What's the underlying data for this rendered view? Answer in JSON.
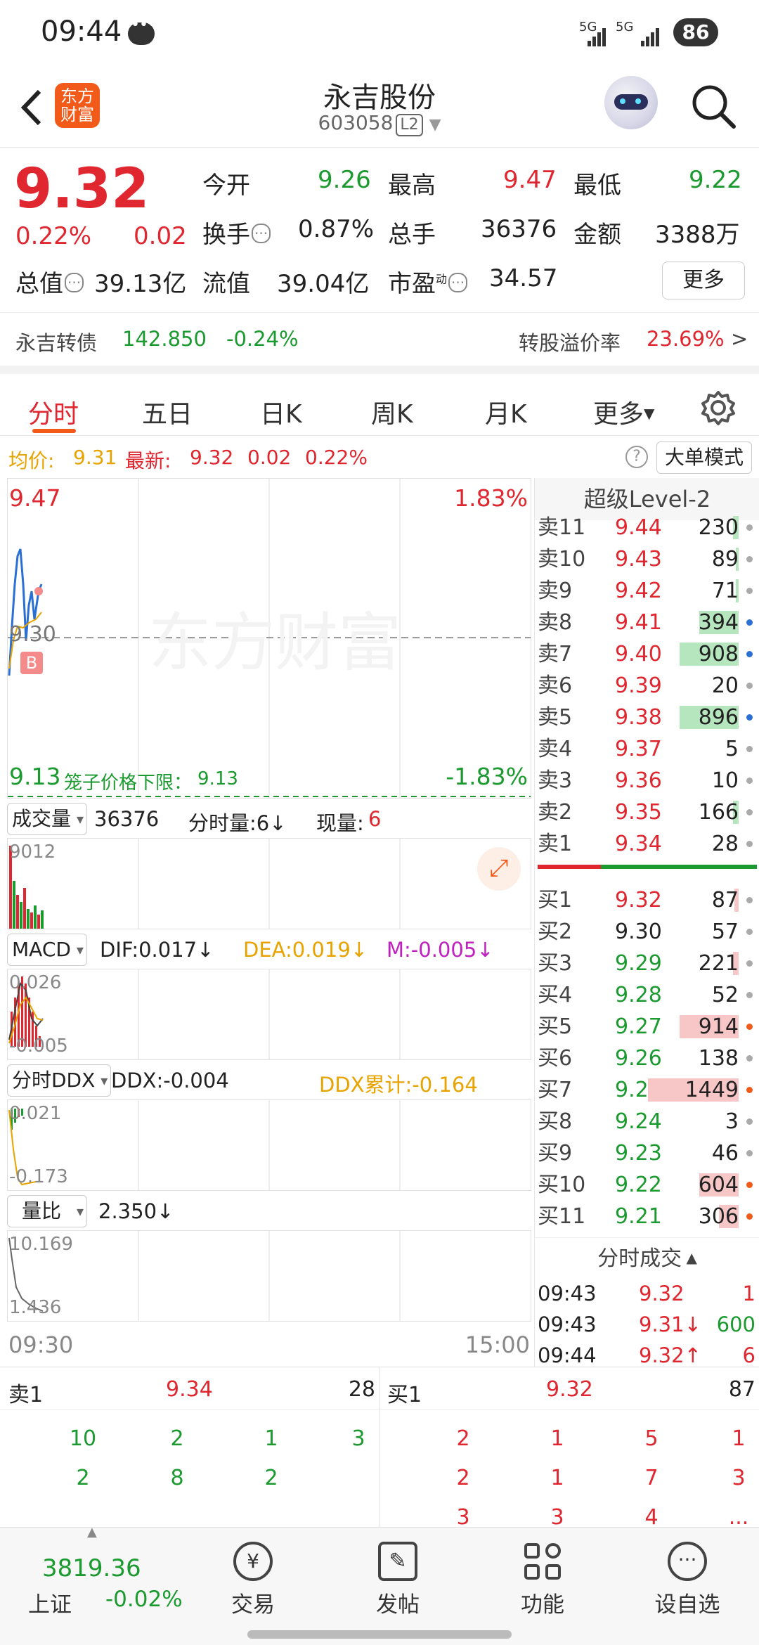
{
  "status": {
    "time": "09:44",
    "net1": "5G",
    "net2": "5G",
    "battery": "86"
  },
  "header": {
    "name": "永吉股份",
    "code": "603058",
    "level_badge": "L2",
    "logo_line1": "东方",
    "logo_line2": "财富"
  },
  "quote": {
    "price": "9.32",
    "change_pct": "0.22%",
    "change": "0.02",
    "open_label": "今开",
    "open": "9.26",
    "high_label": "最高",
    "high": "9.47",
    "low_label": "最低",
    "low": "9.22",
    "turnover_label": "换手",
    "turnover": "0.87%",
    "volume_label": "总手",
    "volume": "36376",
    "amount_label": "金额",
    "amount": "3388万",
    "mcap_label": "总值",
    "mcap": "39.13亿",
    "float_label": "流值",
    "float": "39.04亿",
    "pe_label": "市盈",
    "pe_sup": "动",
    "pe": "34.57",
    "more_label": "更多",
    "bond_name": "永吉转债",
    "bond_price": "142.850",
    "bond_change": "-0.24%",
    "premium_label": "转股溢价率",
    "premium": "23.69%",
    "premium_arrow": ">"
  },
  "tabs": [
    "分时",
    "五日",
    "日K",
    "周K",
    "月K",
    "更多"
  ],
  "avgline": {
    "avg_label": "均价:",
    "avg": "9.31",
    "last_label": "最新:",
    "last": "9.32",
    "chg": "0.02",
    "pct": "0.22%",
    "bigorder": "大单模式"
  },
  "chart": {
    "price_top": "9.47",
    "pct_top": "1.83%",
    "mid": "9.30",
    "price_bottom": "9.13",
    "limit_label": "笼子价格下限：",
    "limit": "9.13",
    "pct_bottom": "-1.83%",
    "watermark": "东方财富",
    "buy_marker": "B",
    "vol_label": "成交量",
    "vol": "36376",
    "vol_tick_label": "分时量:6↓",
    "vol_now_label": "现量:",
    "vol_now": "6",
    "vol_max": "9012",
    "macd_label": "MACD",
    "dif": "DIF:0.017↓",
    "dea": "DEA:0.019↓",
    "m": "M:-0.005↓",
    "macd_max": "0.026",
    "macd_min": "-0.005",
    "ddx_label": "分时DDX",
    "ddx": "DDX:-0.004",
    "ddx_sum": "DDX累计:-0.164",
    "ddx_max": "0.021",
    "ddx_min": "-0.173",
    "lb_label": "量比",
    "lb": "2.350↓",
    "lb_max": "10.169",
    "lb_min": "1.436",
    "time_start": "09:30",
    "time_end": "15:00"
  },
  "book": {
    "title": "超级Level-2",
    "asks": [
      {
        "label": "卖11",
        "price": "9.44",
        "vol": "230",
        "bar": 0.06,
        "dot": "#aaaaaa"
      },
      {
        "label": "卖10",
        "price": "9.43",
        "vol": "89",
        "bar": 0.03,
        "dot": "#aaaaaa"
      },
      {
        "label": "卖9",
        "price": "9.42",
        "vol": "71",
        "bar": 0.03,
        "dot": "#aaaaaa"
      },
      {
        "label": "卖8",
        "price": "9.41",
        "vol": "394",
        "bar": 0.4,
        "dot": "#2a6fd6"
      },
      {
        "label": "卖7",
        "price": "9.40",
        "vol": "908",
        "bar": 0.6,
        "dot": "#2a6fd6"
      },
      {
        "label": "卖6",
        "price": "9.39",
        "vol": "20",
        "bar": 0.0,
        "dot": "#aaaaaa"
      },
      {
        "label": "卖5",
        "price": "9.38",
        "vol": "896",
        "bar": 0.6,
        "dot": "#2a6fd6"
      },
      {
        "label": "卖4",
        "price": "9.37",
        "vol": "5",
        "bar": 0.0,
        "dot": "#aaaaaa"
      },
      {
        "label": "卖3",
        "price": "9.36",
        "vol": "10",
        "bar": 0.0,
        "dot": "#aaaaaa"
      },
      {
        "label": "卖2",
        "price": "9.35",
        "vol": "166",
        "bar": 0.06,
        "dot": "#aaaaaa"
      },
      {
        "label": "卖1",
        "price": "9.34",
        "vol": "28",
        "bar": 0.0,
        "dot": "#aaaaaa"
      }
    ],
    "bids": [
      {
        "label": "买1",
        "price": "9.32",
        "vol": "87",
        "bar": 0.04,
        "dot": "#aaaaaa"
      },
      {
        "label": "买2",
        "price": "9.30",
        "vol": "57",
        "bar": 0.0,
        "dot": "#aaaaaa"
      },
      {
        "label": "买3",
        "price": "9.29",
        "vol": "221",
        "bar": 0.06,
        "dot": "#aaaaaa"
      },
      {
        "label": "买4",
        "price": "9.28",
        "vol": "52",
        "bar": 0.0,
        "dot": "#aaaaaa"
      },
      {
        "label": "买5",
        "price": "9.27",
        "vol": "914",
        "bar": 0.6,
        "dot": "#f25a19"
      },
      {
        "label": "买6",
        "price": "9.26",
        "vol": "138",
        "bar": 0.0,
        "dot": "#aaaaaa"
      },
      {
        "label": "买7",
        "price": "9.25",
        "vol": "1449",
        "bar": 0.92,
        "dot": "#f25a19"
      },
      {
        "label": "买8",
        "price": "9.24",
        "vol": "3",
        "bar": 0.0,
        "dot": "#aaaaaa"
      },
      {
        "label": "买9",
        "price": "9.23",
        "vol": "46",
        "bar": 0.0,
        "dot": "#aaaaaa"
      },
      {
        "label": "买10",
        "price": "9.22",
        "vol": "604",
        "bar": 0.4,
        "dot": "#f25a19"
      },
      {
        "label": "买11",
        "price": "9.21",
        "vol": "306",
        "bar": 0.2,
        "dot": "#f25a19"
      }
    ],
    "ticks_title": "分时成交",
    "ticks": [
      {
        "time": "09:43",
        "price": "9.32",
        "vol": "1",
        "arrow": "",
        "color": "red"
      },
      {
        "time": "09:43",
        "price": "9.31↓",
        "vol": "600",
        "arrow": "",
        "color": "green"
      },
      {
        "time": "09:44",
        "price": "9.32↑",
        "vol": "6",
        "arrow": "",
        "color": "red"
      }
    ]
  },
  "depth": {
    "sell_label": "卖1",
    "sell_price": "9.34",
    "sell_vol": "28",
    "buy_label": "买1",
    "buy_price": "9.32",
    "buy_vol": "87",
    "sell_orders": [
      [
        "10",
        "2",
        "1",
        "3"
      ],
      [
        "2",
        "8",
        "2",
        ""
      ]
    ],
    "buy_orders": [
      [
        "2",
        "1",
        "5",
        "1"
      ],
      [
        "2",
        "1",
        "7",
        "3"
      ],
      [
        "3",
        "3",
        "4",
        "..."
      ]
    ]
  },
  "nav": {
    "index_value": "3819.36",
    "index_name": "上证",
    "index_change": "-0.02%",
    "items": [
      "交易",
      "发帖",
      "功能",
      "设自选"
    ]
  },
  "colors": {
    "up": "#e0262f",
    "down": "#1b9a2f",
    "accent": "#f25a19"
  }
}
